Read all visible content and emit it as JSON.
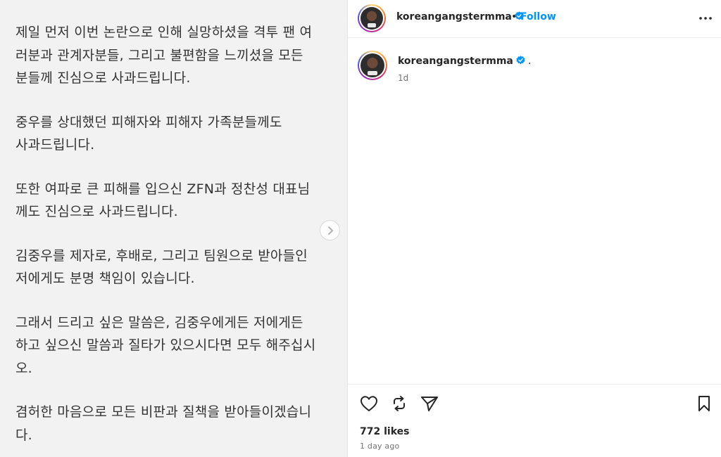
{
  "post": {
    "paragraphs": [
      [
        "제일 먼저 이번 논란으로 인해 실망하셨을 격투 팬 여",
        "러분과 관계자분들, 그리고 불편함을 느끼셨을 모든",
        "분들께 진심으로 사과드립니다."
      ],
      [
        "중우를 상대했던 피해자와 피해자 가족분들께도",
        "사과드립니다."
      ],
      [
        "또한 여파로 큰 피해를 입으신 ZFN과 정찬성 대표님",
        "께도 진심으로 사과드립니다."
      ],
      [
        "김중우를 제자로, 후배로, 그리고 팀원으로 받아들인",
        "저에게도 분명 책임이 있습니다."
      ],
      [
        "그래서 드리고 싶은 말씀은, 김중우에게든 저에게든",
        "하고 싶으신 말씀과 질타가 있으시다면 모두 해주십시",
        "오."
      ],
      [
        "겸허한 마음으로 모든 비판과 질책을 받아들이겠습니",
        "다."
      ]
    ]
  },
  "header": {
    "username": "koreangangstermma",
    "separator": "•",
    "follow_label": "Follow"
  },
  "caption": {
    "username": "koreangangstermma",
    "text": ".",
    "time": "1d"
  },
  "footer": {
    "likes": "772 likes",
    "posted": "1 day ago"
  },
  "colors": {
    "accent": "#0095f6",
    "text": "#262626",
    "muted": "#737373",
    "media_bg": "#f2f2f2"
  },
  "icons": [
    "chevron-right-icon",
    "verified-badge-icon",
    "more-options-icon",
    "heart-icon",
    "repost-icon",
    "share-icon",
    "bookmark-icon"
  ]
}
